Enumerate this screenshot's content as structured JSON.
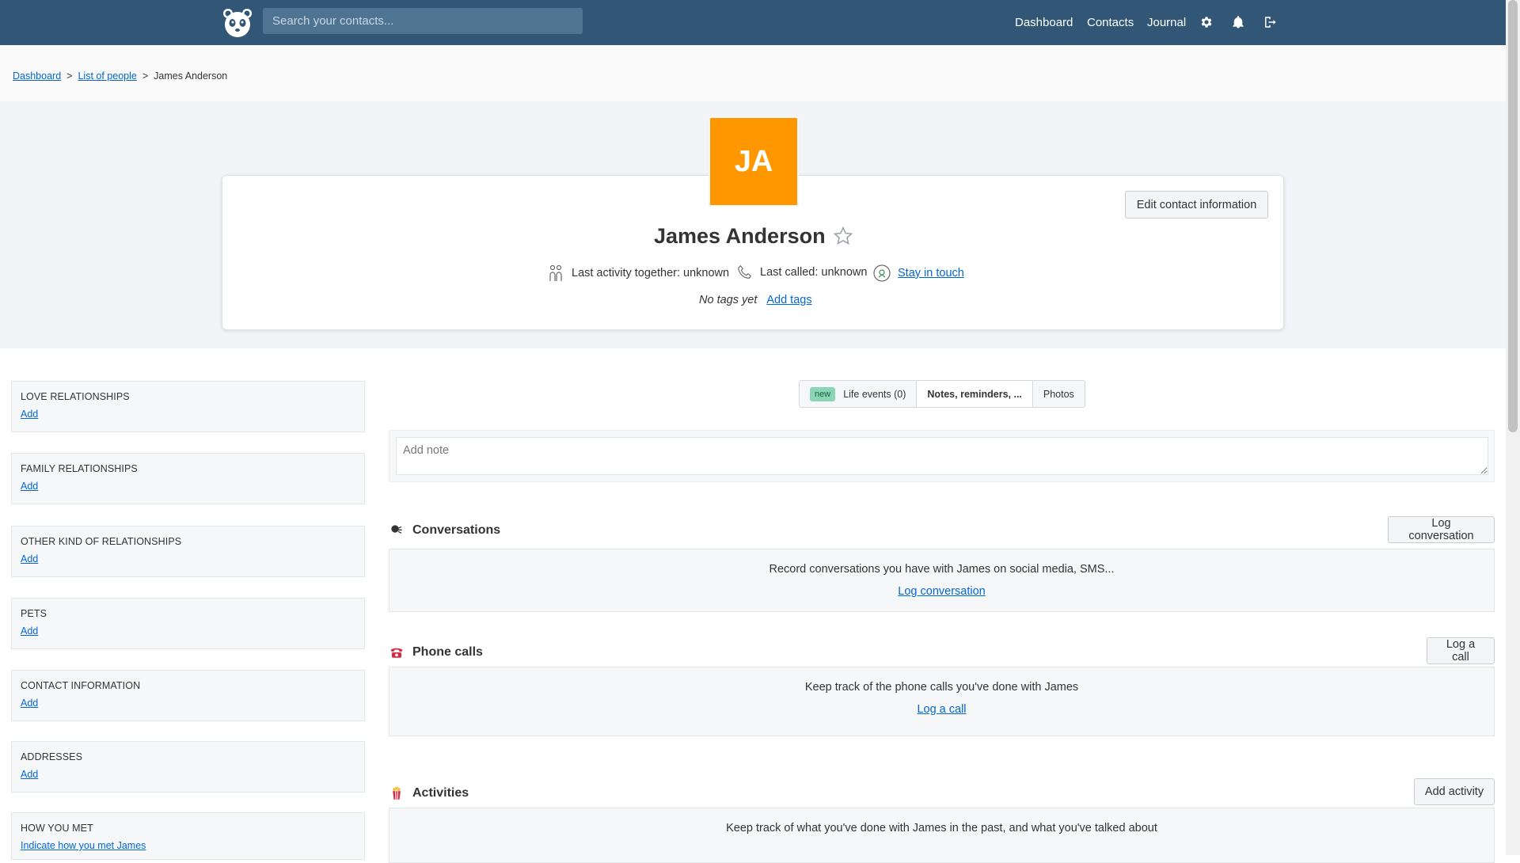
{
  "topbar": {
    "logo": "panda-logo-icon",
    "search_placeholder": "Search your contacts...",
    "nav": [
      "Dashboard",
      "Contacts",
      "Journal"
    ],
    "icons": [
      "gear-icon",
      "bell-icon",
      "logout-icon"
    ],
    "bg_color": "#325776"
  },
  "breadcrumb": {
    "items": [
      "Dashboard",
      "List of people"
    ],
    "separator": ">",
    "current": "James Anderson"
  },
  "profile": {
    "initials": "JA",
    "avatar_color": "#ff9800",
    "name": "James Anderson",
    "edit_label": "Edit contact information",
    "last_activity": "Last activity together: unknown",
    "last_called": "Last called: unknown",
    "stay_in_touch": "Stay in touch",
    "no_tags": "No tags yet",
    "add_tags": "Add tags"
  },
  "sidebar": {
    "sections": [
      {
        "title": "Love relationships",
        "action": "Add"
      },
      {
        "title": "Family relationships",
        "action": "Add"
      },
      {
        "title": "Other kind of relationships",
        "action": "Add"
      },
      {
        "title": "Pets",
        "action": "Add"
      },
      {
        "title": "Contact information",
        "action": "Add"
      },
      {
        "title": "Addresses",
        "action": "Add"
      },
      {
        "title": "How you met",
        "action": "Indicate how you met James"
      }
    ]
  },
  "tabs": {
    "new_badge": "new",
    "items": [
      "Life events (0)",
      "Notes, reminders, ...",
      "Photos"
    ],
    "active_index": 1
  },
  "notes": {
    "placeholder": "Add note"
  },
  "sections": {
    "conversations": {
      "title": "Conversations",
      "button": "Log conversation",
      "description": "Record conversations you have with James on social media, SMS...",
      "link": "Log conversation"
    },
    "phone_calls": {
      "title": "Phone calls",
      "button": "Log a call",
      "description": "Keep track of the phone calls you've done with James",
      "link": "Log a call"
    },
    "activities": {
      "title": "Activities",
      "button": "Add activity",
      "description": "Keep track of what you've done with James in the past, and what you've talked about"
    }
  }
}
